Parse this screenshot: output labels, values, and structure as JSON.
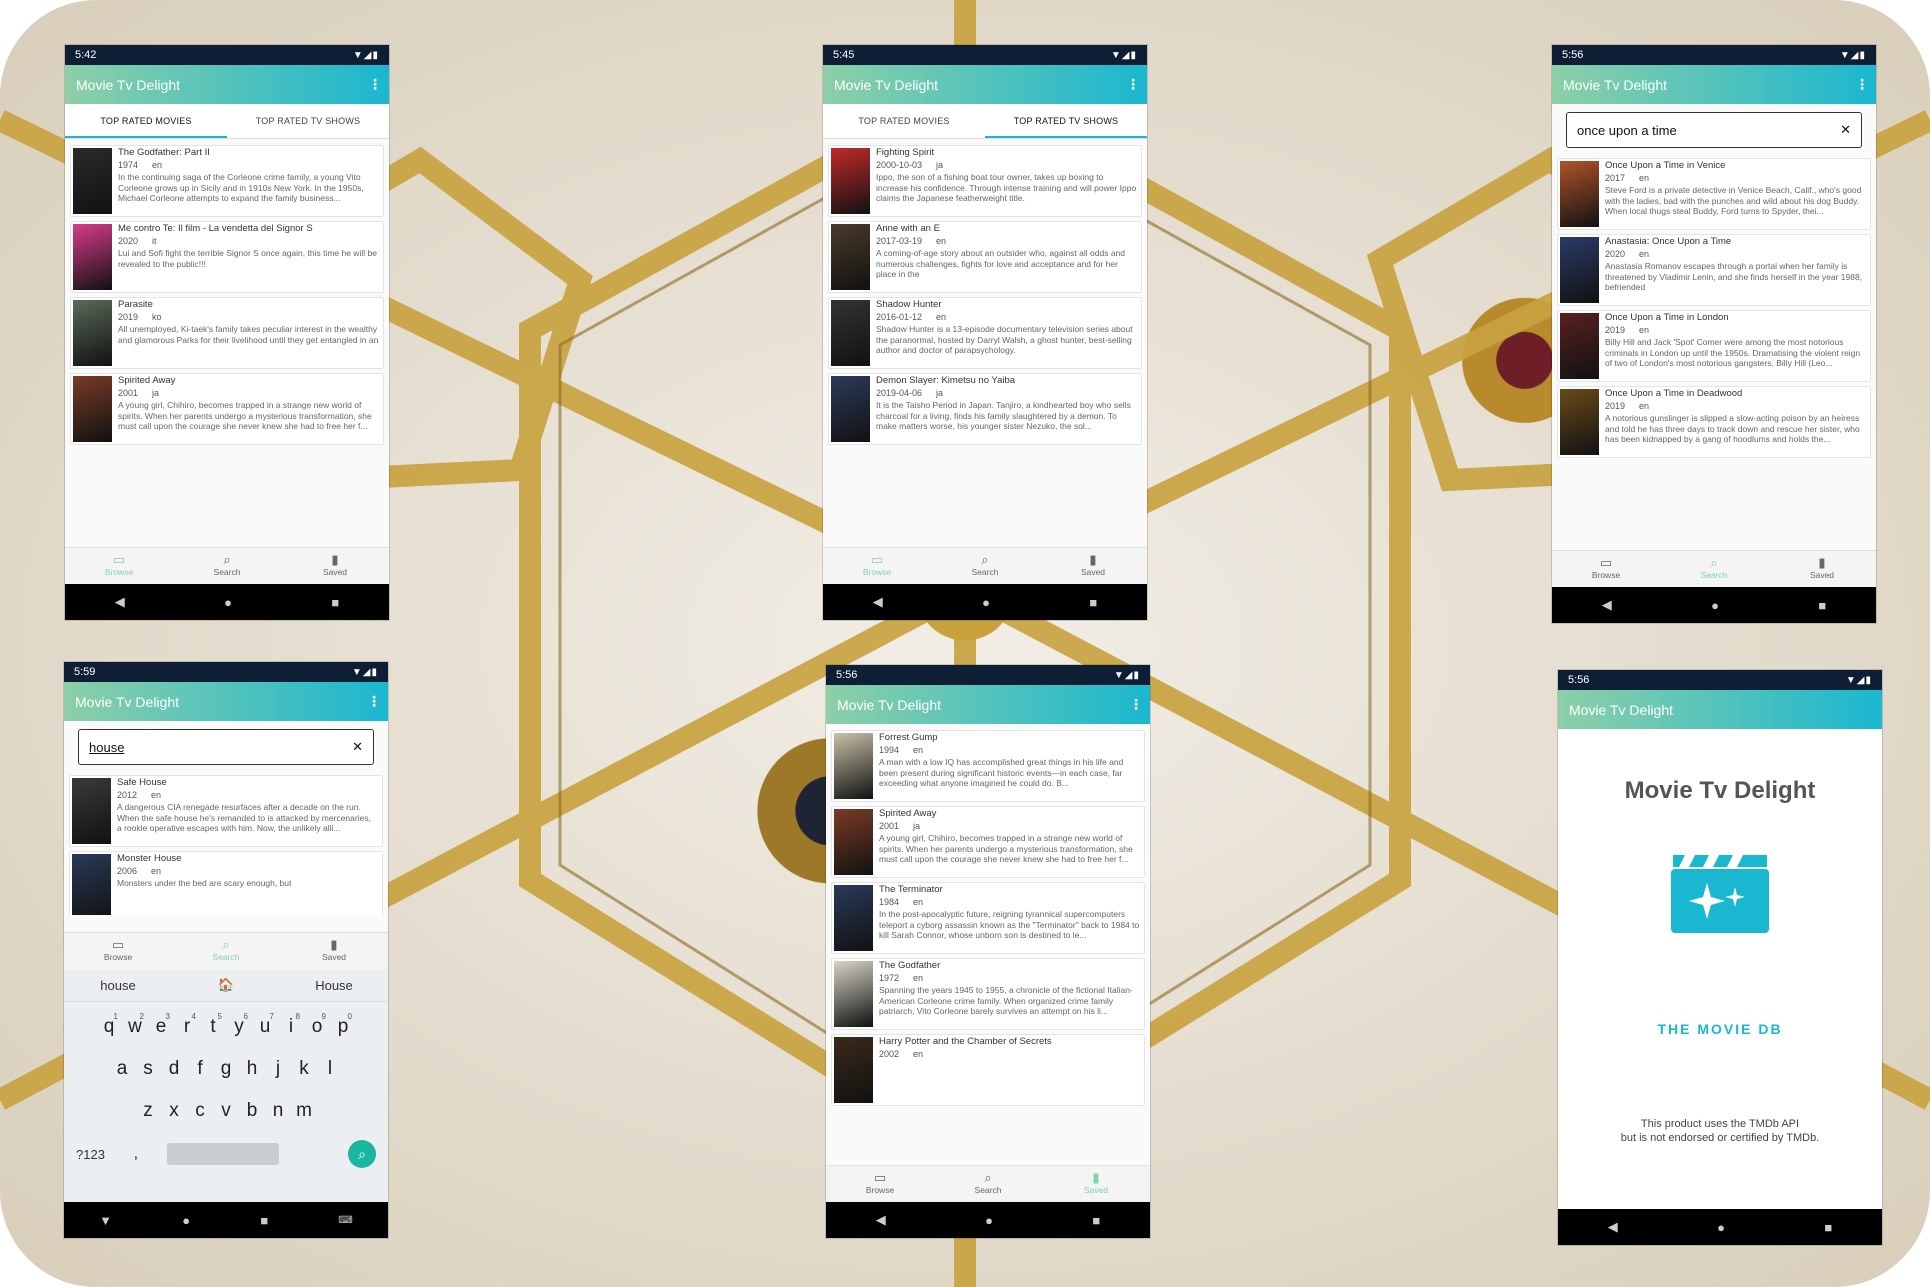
{
  "app": {
    "title": "Movie Tv Delight",
    "colors": {
      "appbar_start": "#8dcfa7",
      "appbar_end": "#1ab7d0",
      "status_bar": "#0e1f35",
      "accent": "#1ab7d0",
      "active_nav": "#7fd3a8"
    }
  },
  "nav_labels": {
    "browse": "Browse",
    "search": "Search",
    "saved": "Saved"
  },
  "icons": {
    "browse": "tv-icon",
    "search": "search-icon",
    "saved": "bookmark-icon",
    "menu": "more-vert-icon",
    "clear": "close-icon",
    "back": "back-icon",
    "home": "home-icon",
    "recents": "recents-icon"
  },
  "screens": [
    {
      "id": "top-movies",
      "time": "5:42",
      "tabs": [
        {
          "label": "TOP RATED MOVIES",
          "active": true
        },
        {
          "label": "TOP RATED TV SHOWS",
          "active": false
        }
      ],
      "cards": [
        {
          "title": "The Godfather: Part II",
          "year": "1974",
          "lang": "en",
          "overview": "In the continuing saga of the Corleone crime family, a young Vito Corleone grows up in Sicily and in 1910s New York. In the 1950s, Michael Corleone attempts to expand the family business...",
          "color": "#2b2b2b"
        },
        {
          "title": "Me contro Te: Il film - La vendetta del Signor S",
          "year": "2020",
          "lang": "it",
          "overview": "Lui and Sofi fight the terrible Signor S once again, this time he will be revealed to the public!!!",
          "color": "#d83b8c"
        },
        {
          "title": "Parasite",
          "year": "2019",
          "lang": "ko",
          "overview": "All unemployed, Ki-taek's family takes peculiar interest in the wealthy and glamorous Parks for their livelihood until they get entangled in an",
          "color": "#5a6a5a"
        },
        {
          "title": "Spirited Away",
          "year": "2001",
          "lang": "ja",
          "overview": "A young girl, Chihiro, becomes trapped in a strange new world of spirits. When her parents undergo a mysterious transformation, she must call upon the courage she never knew she had to free her f...",
          "color": "#7a3b26"
        }
      ]
    },
    {
      "id": "top-tv",
      "time": "5:45",
      "tabs": [
        {
          "label": "TOP RATED MOVIES",
          "active": false
        },
        {
          "label": "TOP RATED TV SHOWS",
          "active": true
        }
      ],
      "cards": [
        {
          "title": "Fighting Spirit",
          "year": "2000-10-03",
          "lang": "ja",
          "overview": "Ippo, the son of a fishing boat tour owner, takes up boxing to increase his confidence. Through intense training and will power Ippo claims the Japanese featherweight title.",
          "color": "#c22a2a"
        },
        {
          "title": "Anne with an E",
          "year": "2017-03-19",
          "lang": "en",
          "overview": "A coming-of-age story about an outsider who, against all odds and numerous challenges, fights for love and acceptance and for her place in the",
          "color": "#4a3a2a"
        },
        {
          "title": "Shadow Hunter",
          "year": "2016-01-12",
          "lang": "en",
          "overview": "Shadow Hunter is a 13-episode documentary television series about the paranormal, hosted by Darryl Walsh, a ghost hunter, best-selling author and doctor of parapsychology.",
          "color": "#333333"
        },
        {
          "title": "Demon Slayer: Kimetsu no Yaiba",
          "year": "2019-04-06",
          "lang": "ja",
          "overview": "It is the Taisho Period in Japan. Tanjiro, a kindhearted boy who sells charcoal for a living, finds his family slaughtered by a demon. To make matters worse, his younger sister Nezuko, the sol...",
          "color": "#2c3a5a"
        }
      ]
    },
    {
      "id": "search-once",
      "time": "5:56",
      "query": "once upon a time",
      "cards": [
        {
          "title": "Once Upon a Time in Venice",
          "year": "2017",
          "lang": "en",
          "overview": "Steve Ford is a private detective in Venice Beach, Calif., who's good with the ladies, bad with the punches and wild about his dog Buddy. When local thugs steal Buddy, Ford turns to Spyder, thei...",
          "color": "#b0532a"
        },
        {
          "title": "Anastasia: Once Upon a Time",
          "year": "2020",
          "lang": "en",
          "overview": "Anastasia Romanov escapes through a portal when her family is threatened by Vladimir Lenin, and she finds herself in the year 1988, befriended",
          "color": "#2a3a6a"
        },
        {
          "title": "Once Upon a Time in London",
          "year": "2019",
          "lang": "en",
          "overview": "Billy Hill and Jack 'Spot' Comer were among the most notorious criminals in London up until the 1950s. Dramatising the violent reign of two of London's most notorious gangsters, Billy Hill (Leo...",
          "color": "#5a2020"
        },
        {
          "title": "Once Upon a Time in Deadwood",
          "year": "2019",
          "lang": "en",
          "overview": "A notorious gunslinger is slipped a slow-acting poison by an heiress and told he has three days to track down and rescue her sister, who has been kidnapped by a gang of hoodlums and holds the...",
          "color": "#6a4a1a"
        }
      ]
    },
    {
      "id": "search-house",
      "time": "5:59",
      "query": "house",
      "cards": [
        {
          "title": "Safe House",
          "year": "2012",
          "lang": "en",
          "overview": "A dangerous CIA renegade resurfaces after a decade on the run. When the safe house he's remanded to is attacked by mercenaries, a rookie operative escapes with him. Now, the unlikely alli...",
          "color": "#3a3a3a"
        },
        {
          "title": "Monster House",
          "year": "2006",
          "lang": "en",
          "overview": "Monsters under the bed are scary enough, but",
          "color": "#2a3a5a"
        }
      ],
      "suggestions": [
        "house",
        "🏠",
        "House"
      ],
      "keyboard_rows": [
        [
          "q",
          "w",
          "e",
          "r",
          "t",
          "y",
          "u",
          "i",
          "o",
          "p"
        ],
        [
          "a",
          "s",
          "d",
          "f",
          "g",
          "h",
          "j",
          "k",
          "l"
        ],
        [
          "z",
          "x",
          "c",
          "v",
          "b",
          "n",
          "m"
        ]
      ],
      "number_hints": [
        "1",
        "2",
        "3",
        "4",
        "5",
        "6",
        "7",
        "8",
        "9",
        "0"
      ],
      "symbols_key": "?123",
      "comma_key": ","
    },
    {
      "id": "saved",
      "time": "5:56",
      "cards": [
        {
          "title": "Forrest Gump",
          "year": "1994",
          "lang": "en",
          "overview": "A man with a low IQ has accomplished great things in his life and been present during significant historic events—in each case, far exceeding what anyone imagined he could do. B...",
          "color": "#c9c0a8"
        },
        {
          "title": "Spirited Away",
          "year": "2001",
          "lang": "ja",
          "overview": "A young girl, Chihiro, becomes trapped in a strange new world of spirits. When her parents undergo a mysterious transformation, she must call upon the courage she never knew she had to free her f...",
          "color": "#7a3b26"
        },
        {
          "title": "The Terminator",
          "year": "1984",
          "lang": "en",
          "overview": "In the post-apocalyptic future, reigning tyrannical supercomputers teleport a cyborg assassin known as the \"Terminator\" back to 1984 to kill Sarah Connor, whose unborn son is destined to le...",
          "color": "#2a3a5a"
        },
        {
          "title": "The Godfather",
          "year": "1972",
          "lang": "en",
          "overview": "Spanning the years 1945 to 1955, a chronicle of the fictional Italian-American Corleone crime family. When organized crime family patriarch, Vito Corleone barely survives an attempt on his li...",
          "color": "#d8d4c8"
        },
        {
          "title": "Harry Potter and the Chamber of Secrets",
          "year": "2002",
          "lang": "en",
          "overview": "",
          "color": "#3a2a1a"
        }
      ]
    },
    {
      "id": "splash",
      "time": "5:56",
      "heading": "Movie Tv Delight",
      "tmdb_text": "THE MOVIE DB",
      "disclaimer_line1": "This product uses the TMDb API",
      "disclaimer_line2": "but is not endorsed or certified by TMDb."
    }
  ]
}
